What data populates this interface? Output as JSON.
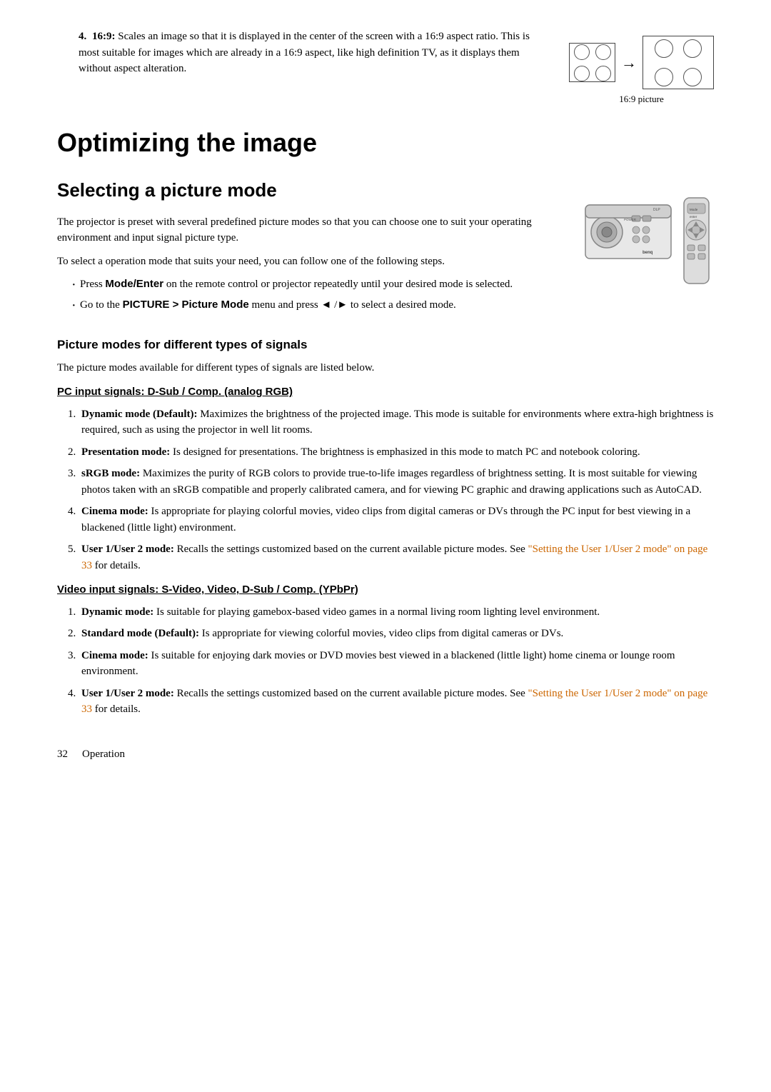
{
  "intro": {
    "item4": {
      "number": "4.",
      "label_bold": "16:9:",
      "text": " Scales an image so that it is displayed in the center of the screen with a 16:9 aspect ratio. This is most suitable for images which are already in a 16:9 aspect, like high definition TV, as it displays them without aspect alteration.",
      "diagram_label": "16:9 picture"
    }
  },
  "main_heading": "Optimizing the image",
  "sub_heading": "Selecting a picture mode",
  "selecting_description1": "The projector is preset with several predefined picture modes so that you can choose one to suit your operating environment and input signal picture type.",
  "selecting_description2": "To select a operation mode that suits your need, you can follow one of the following steps.",
  "bullet1_prefix": "Press ",
  "bullet1_bold": "Mode/Enter",
  "bullet1_text": " on the remote control or projector repeatedly until your desired mode is selected.",
  "bullet2_text1": "Go to the ",
  "bullet2_bold1": "PICTURE > Picture Mode",
  "bullet2_text2": " menu and press ◄ /► to select a desired mode.",
  "picture_modes_heading": "Picture modes for different types of signals",
  "picture_modes_desc": "The picture modes available for different types of signals are listed below.",
  "pc_signals_heading": "PC input signals: D-Sub / Comp. (analog RGB)",
  "pc_items": [
    {
      "bold": "Dynamic mode (Default):",
      "text": " Maximizes the brightness of the projected image. This mode is suitable for environments where extra-high brightness is required, such as using the projector in well lit rooms."
    },
    {
      "bold": "Presentation mode:",
      "text": " Is designed for presentations. The brightness is emphasized in this mode to match PC and notebook coloring."
    },
    {
      "bold": "sRGB mode:",
      "text": " Maximizes the purity of RGB colors to provide true-to-life images regardless of brightness setting. It is most suitable for viewing photos taken with an sRGB compatible and properly calibrated camera, and for viewing PC graphic and drawing applications such as AutoCAD."
    },
    {
      "bold": "Cinema mode:",
      "text": " Is appropriate for playing colorful movies, video clips from digital cameras or DVs through the PC input for best viewing in a blackened (little light) environment."
    },
    {
      "bold": "User 1/User 2 mode:",
      "text": " Recalls the settings customized based on the current available picture modes. See ",
      "link_text": "\"Setting the User 1/User 2 mode\" on page 33",
      "text2": " for details."
    }
  ],
  "video_signals_heading": "Video input signals: S-Video, Video, D-Sub / Comp. (YPbPr)",
  "video_items": [
    {
      "bold": "Dynamic mode:",
      "text": " Is suitable for playing gamebox-based video games in a normal living room lighting level environment."
    },
    {
      "bold": "Standard mode (Default):",
      "text": " Is appropriate for viewing colorful movies, video clips from digital cameras or DVs."
    },
    {
      "bold": "Cinema mode:",
      "text": " Is suitable for enjoying dark movies or DVD movies best viewed in a blackened (little light) home cinema or lounge room environment."
    },
    {
      "bold": "User 1/User 2 mode:",
      "text": " Recalls the settings customized based on the current available picture modes. See ",
      "link_text": "\"Setting the User 1/User 2 mode\" on page 33",
      "text2": " for details."
    }
  ],
  "footer_page": "32",
  "footer_section": "Operation",
  "link_color": "#cc5500"
}
